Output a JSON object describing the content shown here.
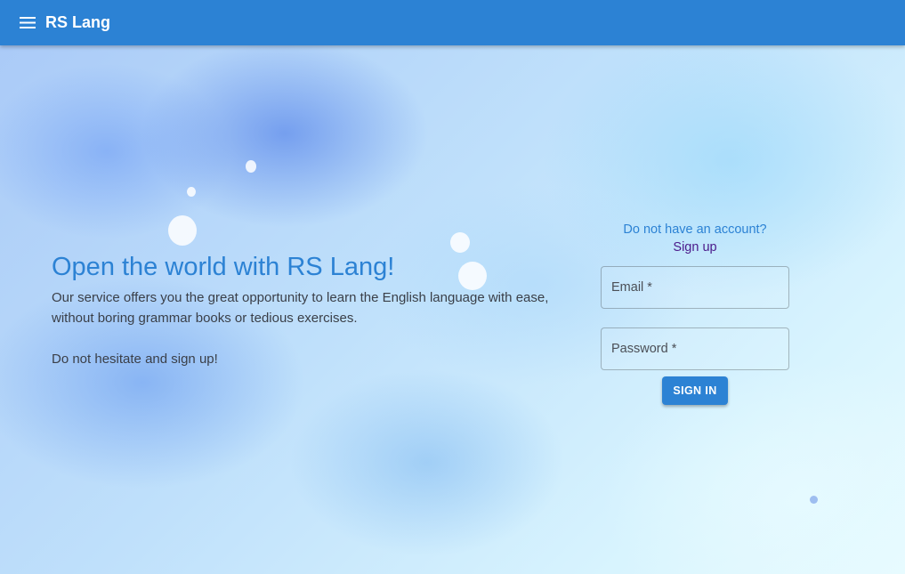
{
  "appbar": {
    "title": "RS Lang",
    "menu_icon": "menu-icon"
  },
  "hero": {
    "heading": "Open the world with RS Lang!",
    "description": "Our service offers you the great opportunity to learn the English language with ease, without boring grammar books or tedious exercises.",
    "cta": "Do not hesitate and sign up!"
  },
  "auth": {
    "no_account": "Do not have an account?",
    "signup_link": "Sign up",
    "email_label": "Email *",
    "password_label": "Password *",
    "signin_button": "SIGN IN"
  },
  "colors": {
    "primary": "#2c82d4",
    "link_visited": "#4b1a8a",
    "text": "#3a3f48"
  }
}
